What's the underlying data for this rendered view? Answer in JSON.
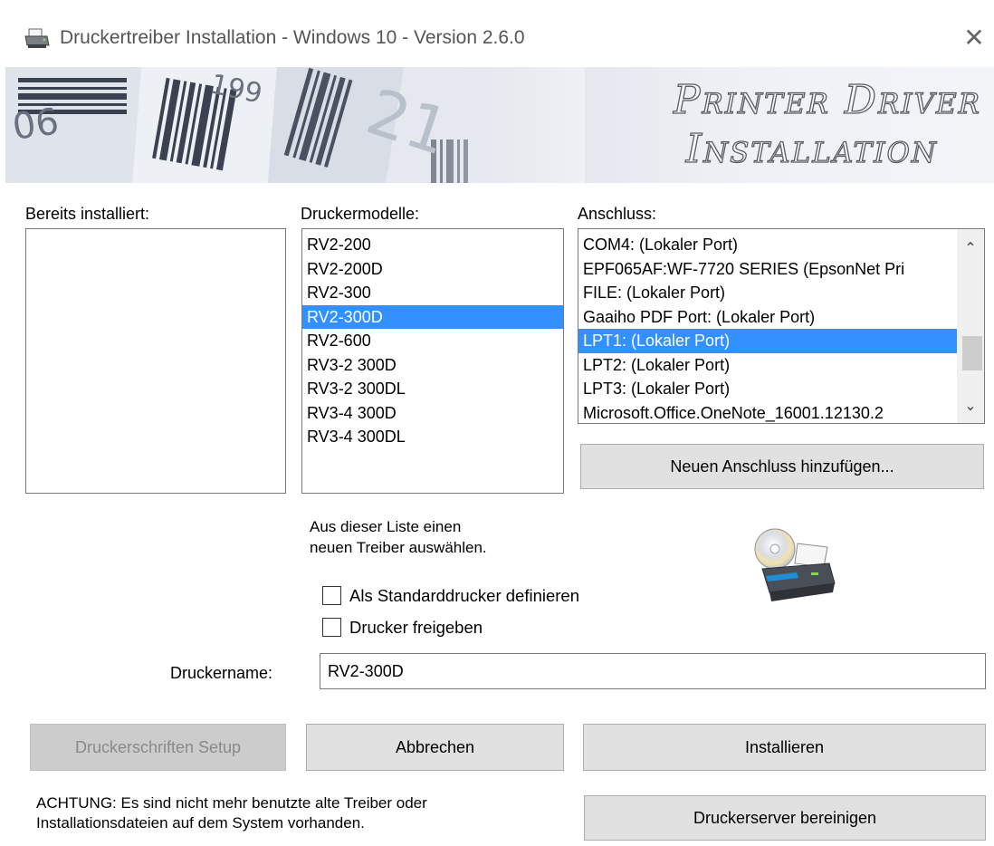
{
  "window": {
    "title": "Druckertreiber Installation - Windows 10 - Version 2.6.0",
    "close_label": "✕"
  },
  "banner": {
    "line1": "Printer Driver",
    "line2": "Installation"
  },
  "installed": {
    "label": "Bereits installiert:",
    "items": []
  },
  "models": {
    "label": "Druckermodelle:",
    "items": [
      "RV2-200",
      "RV2-200D",
      "RV2-300",
      "RV2-300D",
      "RV2-600",
      "RV3-2 300D",
      "RV3-2 300DL",
      "RV3-4 300D",
      "RV3-4 300DL"
    ],
    "selected_index": 3
  },
  "ports": {
    "label": "Anschluss:",
    "items": [
      "COM4: (Lokaler Port)",
      "EPF065AF:WF-7720 SERIES (EpsonNet Pri",
      "FILE: (Lokaler Port)",
      "Gaaiho PDF Port: (Lokaler Port)",
      "LPT1: (Lokaler Port)",
      "LPT2: (Lokaler Port)",
      "LPT3: (Lokaler Port)",
      "Microsoft.Office.OneNote_16001.12130.2"
    ],
    "selected_index": 4,
    "scroll_up": "⌃",
    "scroll_down": "⌄",
    "add_button": "Neuen Anschluss hinzufügen..."
  },
  "hint": {
    "line1": "Aus dieser Liste einen",
    "line2": "neuen Treiber auswählen."
  },
  "options": {
    "default_printer_label": "Als Standarddrucker definieren",
    "default_printer_checked": false,
    "share_label": "Drucker freigeben",
    "share_checked": false
  },
  "printer_name": {
    "label": "Druckername:",
    "value": "RV2-300D"
  },
  "buttons": {
    "fonts_setup": "Druckerschriften Setup",
    "cancel": "Abbrechen",
    "install": "Installieren",
    "cleanup": "Druckerserver bereinigen"
  },
  "warning": {
    "line1": "ACHTUNG: Es sind nicht mehr benutzte alte Treiber oder",
    "line2": "Installationsdateien auf dem System vorhanden."
  },
  "colors": {
    "selection": "#3390ff",
    "button_face": "#e1e1e1"
  },
  "icons": [
    "printer-app-icon",
    "close-icon",
    "barcode-banner-graphic",
    "printer-cd-icon",
    "chevron-up-icon",
    "chevron-down-icon"
  ]
}
